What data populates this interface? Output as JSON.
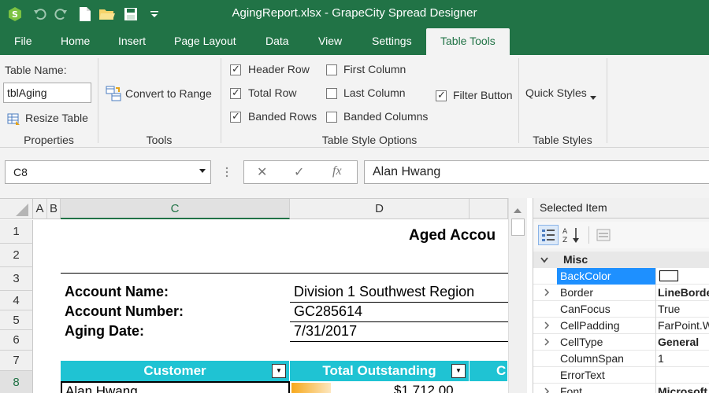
{
  "window": {
    "title": "AgingReport.xlsx - GrapeCity Spread Designer"
  },
  "colors": {
    "accent": "#217346",
    "table_header": "#1fc3d3",
    "selected_row": "#1e90ff"
  },
  "quick_access": [
    {
      "icon": "spread-logo-icon"
    },
    {
      "icon": "undo-icon"
    },
    {
      "icon": "redo-icon"
    },
    {
      "icon": "new-file-icon"
    },
    {
      "icon": "open-folder-icon"
    },
    {
      "icon": "save-icon"
    },
    {
      "icon": "customize-dropdown-icon"
    }
  ],
  "menu": {
    "file": "File",
    "home": "Home",
    "insert": "Insert",
    "page_layout": "Page Layout",
    "data": "Data",
    "view": "View",
    "settings": "Settings",
    "table_tools": "Table Tools"
  },
  "ribbon": {
    "table_name_label": "Table Name:",
    "table_name_value": "tblAging",
    "resize_table": "Resize Table",
    "properties_group": "Properties",
    "convert_to_range": "Convert to Range",
    "tools_group": "Tools",
    "options": {
      "header_row": {
        "label": "Header Row",
        "checked": true
      },
      "total_row": {
        "label": "Total Row",
        "checked": true
      },
      "banded_rows": {
        "label": "Banded Rows",
        "checked": true
      },
      "first_column": {
        "label": "First Column",
        "checked": false
      },
      "last_column": {
        "label": "Last Column",
        "checked": false
      },
      "banded_columns": {
        "label": "Banded Columns",
        "checked": false
      },
      "filter_button": {
        "label": "Filter Button",
        "checked": true
      }
    },
    "style_options_group": "Table Style Options",
    "quick_styles": "Quick Styles",
    "table_styles_group": "Table Styles"
  },
  "formula_bar": {
    "cell_ref": "C8",
    "cancel_symbol": "✕",
    "enter_symbol": "✓",
    "fx_symbol": "fx",
    "value": "Alan Hwang"
  },
  "sheet": {
    "columns": [
      "A",
      "B",
      "C",
      "D"
    ],
    "rows": [
      "1",
      "2",
      "3",
      "4",
      "5",
      "6",
      "7",
      "8"
    ],
    "report_title": "Aged Accou",
    "account_name_label": "Account Name:",
    "account_name_value": "Division 1 Southwest Region",
    "account_number_label": "Account Number:",
    "account_number_value": "GC285614",
    "aging_date_label": "Aging Date:",
    "aging_date_value": "7/31/2017",
    "table_headers": [
      "Customer",
      "Total Outstanding",
      "C"
    ],
    "first_row": {
      "customer": "Alan Hwang",
      "total": "$1,712.00"
    }
  },
  "properties_panel": {
    "header": "Selected Item",
    "category": "Misc",
    "rows": [
      {
        "name": "BackColor",
        "value": "",
        "expandable": false,
        "selected": true
      },
      {
        "name": "Border",
        "value": "LineBorder",
        "expandable": true,
        "bold": true
      },
      {
        "name": "CanFocus",
        "value": "True",
        "expandable": false
      },
      {
        "name": "CellPadding",
        "value": "FarPoint.Win",
        "expandable": true
      },
      {
        "name": "CellType",
        "value": "General",
        "expandable": true,
        "bold": true
      },
      {
        "name": "ColumnSpan",
        "value": "1",
        "expandable": false
      },
      {
        "name": "ErrorText",
        "value": "",
        "expandable": false
      },
      {
        "name": "Font",
        "value": "Microsoft",
        "expandable": true,
        "bold": true
      }
    ]
  }
}
